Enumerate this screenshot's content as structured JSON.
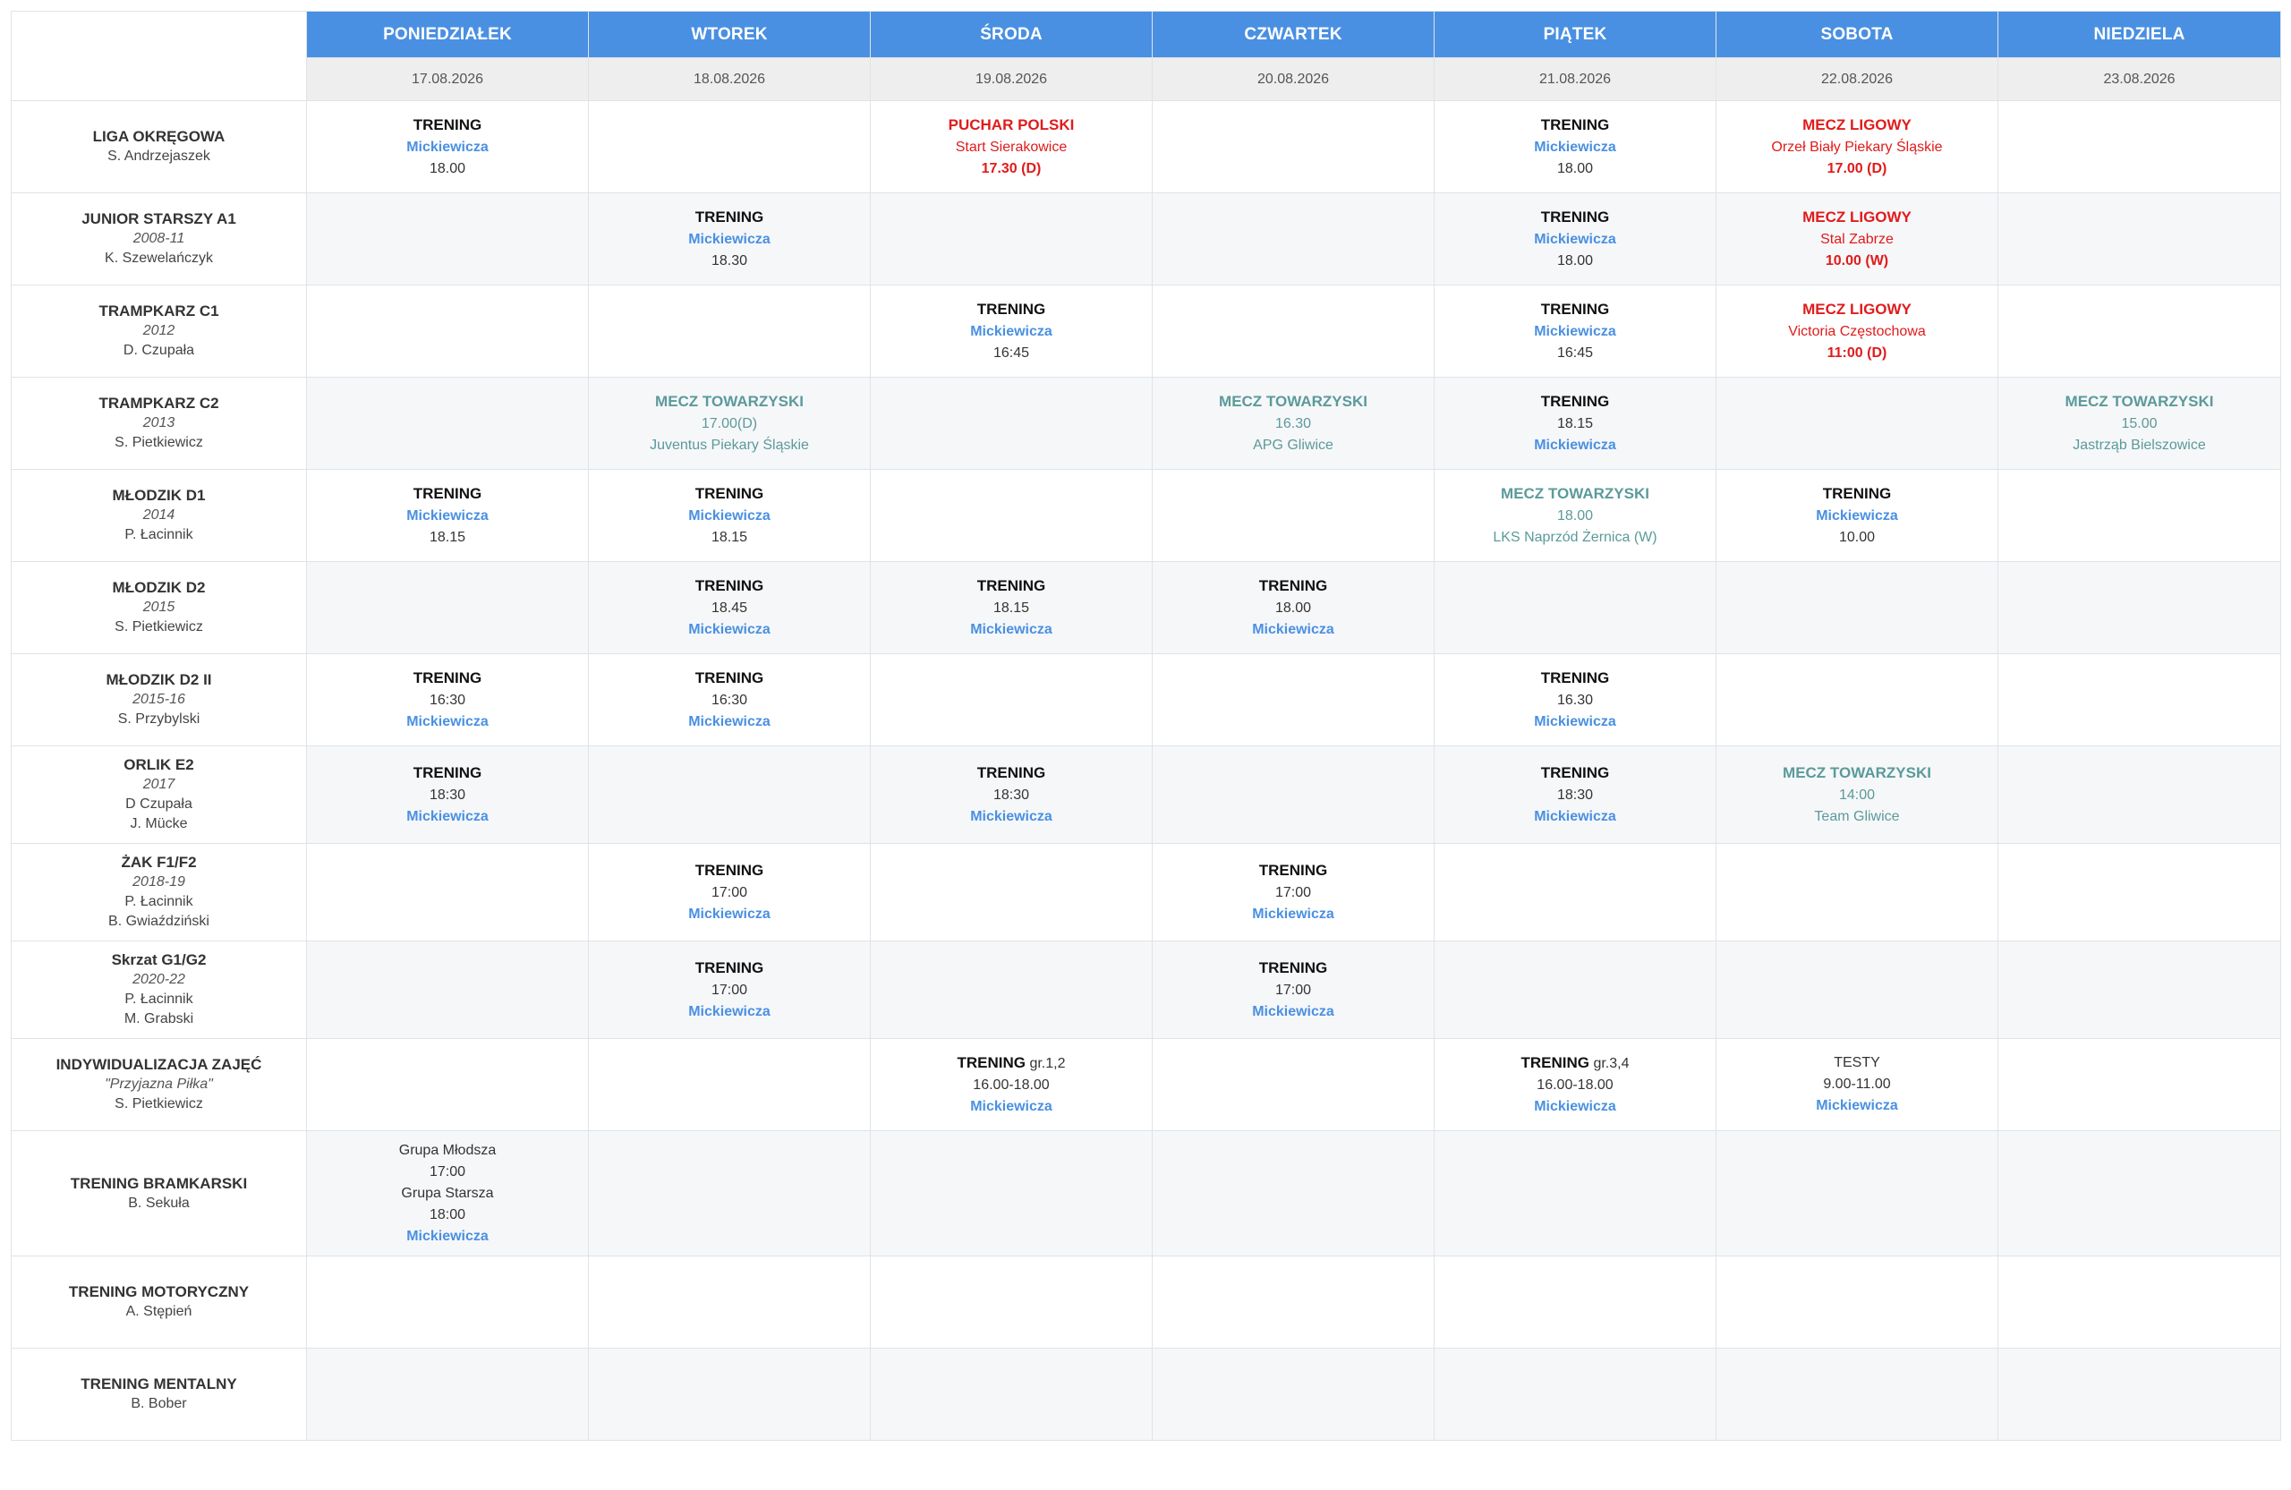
{
  "days": [
    {
      "name": "PONIEDZIAŁEK",
      "date": "17.08.2026"
    },
    {
      "name": "WTOREK",
      "date": "18.08.2026"
    },
    {
      "name": "ŚRODA",
      "date": "19.08.2026"
    },
    {
      "name": "CZWARTEK",
      "date": "20.08.2026"
    },
    {
      "name": "PIĄTEK",
      "date": "21.08.2026"
    },
    {
      "name": "SOBOTA",
      "date": "22.08.2026"
    },
    {
      "name": "NIEDZIELA",
      "date": "23.08.2026"
    }
  ],
  "rows": [
    {
      "name": "LIGA OKRĘGOWA",
      "year": "",
      "coaches": [
        "S. Andrzejaszek"
      ],
      "height": 103,
      "cells": [
        [
          {
            "t": "TRENING",
            "k": "trening"
          },
          {
            "t": "Mickiewicza",
            "k": "place"
          },
          {
            "t": "18.00",
            "k": "time"
          }
        ],
        [],
        [
          {
            "t": "PUCHAR POLSKI",
            "k": "mecz"
          },
          {
            "t": "Start Sierakowice",
            "k": "mecz-sub"
          },
          {
            "t": "17.30 (D)",
            "k": "mecz-time"
          }
        ],
        [],
        [
          {
            "t": "TRENING",
            "k": "trening"
          },
          {
            "t": "Mickiewicza",
            "k": "place"
          },
          {
            "t": "18.00",
            "k": "time"
          }
        ],
        [
          {
            "t": "MECZ LIGOWY",
            "k": "mecz"
          },
          {
            "t": "Orzeł Biały Piekary Śląskie",
            "k": "mecz-sub"
          },
          {
            "t": "17.00 (D)",
            "k": "mecz-time"
          }
        ],
        []
      ]
    },
    {
      "name": "JUNIOR STARSZY A1",
      "year": "2008-11",
      "coaches": [
        "K. Szewelańczyk"
      ],
      "height": 103,
      "cells": [
        [],
        [
          {
            "t": "TRENING",
            "k": "trening"
          },
          {
            "t": "Mickiewicza",
            "k": "place"
          },
          {
            "t": "18.30",
            "k": "time"
          }
        ],
        [],
        [],
        [
          {
            "t": "TRENING",
            "k": "trening"
          },
          {
            "t": "Mickiewicza",
            "k": "place"
          },
          {
            "t": "18.00",
            "k": "time"
          }
        ],
        [
          {
            "t": "MECZ LIGOWY",
            "k": "mecz"
          },
          {
            "t": "Stal Zabrze",
            "k": "mecz-sub"
          },
          {
            "t": "10.00 (W)",
            "k": "mecz-time"
          }
        ],
        []
      ]
    },
    {
      "name": "TRAMPKARZ C1",
      "year": "2012",
      "coaches": [
        "D. Czupała"
      ],
      "height": 103,
      "cells": [
        [],
        [],
        [
          {
            "t": "TRENING",
            "k": "trening"
          },
          {
            "t": "Mickiewicza",
            "k": "place"
          },
          {
            "t": "16:45",
            "k": "time"
          }
        ],
        [],
        [
          {
            "t": "TRENING",
            "k": "trening"
          },
          {
            "t": "Mickiewicza",
            "k": "place"
          },
          {
            "t": "16:45",
            "k": "time"
          }
        ],
        [
          {
            "t": "MECZ LIGOWY",
            "k": "mecz"
          },
          {
            "t": "Victoria Częstochowa",
            "k": "mecz-sub"
          },
          {
            "t": "11:00 (D)",
            "k": "mecz-time"
          }
        ],
        []
      ]
    },
    {
      "name": "TRAMPKARZ C2",
      "year": "2013",
      "coaches": [
        "S. Pietkiewicz"
      ],
      "height": 103,
      "cells": [
        [],
        [
          {
            "t": "MECZ TOWARZYSKI",
            "k": "friendly"
          },
          {
            "t": "17.00(D)",
            "k": "friendly-sub"
          },
          {
            "t": "Juventus Piekary Śląskie",
            "k": "friendly-sub"
          }
        ],
        [],
        [
          {
            "t": "MECZ TOWARZYSKI",
            "k": "friendly"
          },
          {
            "t": "16.30",
            "k": "friendly-sub"
          },
          {
            "t": "APG Gliwice",
            "k": "friendly-sub"
          }
        ],
        [
          {
            "t": "TRENING",
            "k": "trening"
          },
          {
            "t": "18.15",
            "k": "time"
          },
          {
            "t": "Mickiewicza",
            "k": "place"
          }
        ],
        [],
        [
          {
            "t": "MECZ TOWARZYSKI",
            "k": "friendly"
          },
          {
            "t": "15.00",
            "k": "friendly-sub"
          },
          {
            "t": "Jastrząb Bielszowice",
            "k": "friendly-sub"
          }
        ]
      ]
    },
    {
      "name": "MŁODZIK D1",
      "year": "2014",
      "coaches": [
        "P. Łacinnik"
      ],
      "height": 103,
      "cells": [
        [
          {
            "t": "TRENING",
            "k": "trening"
          },
          {
            "t": "Mickiewicza",
            "k": "place"
          },
          {
            "t": "18.15",
            "k": "time"
          }
        ],
        [
          {
            "t": "TRENING",
            "k": "trening"
          },
          {
            "t": "Mickiewicza",
            "k": "place"
          },
          {
            "t": "18.15",
            "k": "time"
          }
        ],
        [],
        [],
        [
          {
            "t": "MECZ TOWARZYSKI",
            "k": "friendly"
          },
          {
            "t": "18.00",
            "k": "friendly-sub"
          },
          {
            "t": "LKS Naprzód Żernica (W)",
            "k": "friendly-sub"
          }
        ],
        [
          {
            "t": "TRENING",
            "k": "trening"
          },
          {
            "t": "Mickiewicza",
            "k": "place"
          },
          {
            "t": "10.00",
            "k": "time"
          }
        ],
        []
      ]
    },
    {
      "name": "MŁODZIK D2",
      "year": "2015",
      "coaches": [
        "S. Pietkiewicz"
      ],
      "height": 103,
      "cells": [
        [],
        [
          {
            "t": "TRENING",
            "k": "trening"
          },
          {
            "t": "18.45",
            "k": "time"
          },
          {
            "t": "Mickiewicza",
            "k": "place"
          }
        ],
        [
          {
            "t": "TRENING",
            "k": "trening"
          },
          {
            "t": "18.15",
            "k": "time"
          },
          {
            "t": "Mickiewicza",
            "k": "place"
          }
        ],
        [
          {
            "t": "TRENING",
            "k": "trening"
          },
          {
            "t": "18.00",
            "k": "time"
          },
          {
            "t": "Mickiewicza",
            "k": "place"
          }
        ],
        [],
        [],
        []
      ]
    },
    {
      "name": "MŁODZIK D2 II",
      "year": "2015-16",
      "coaches": [
        "S. Przybylski"
      ],
      "height": 103,
      "cells": [
        [
          {
            "t": "TRENING",
            "k": "trening"
          },
          {
            "t": "16:30",
            "k": "time"
          },
          {
            "t": "Mickiewicza",
            "k": "place"
          }
        ],
        [
          {
            "t": "TRENING",
            "k": "trening"
          },
          {
            "t": "16:30",
            "k": "time"
          },
          {
            "t": "Mickiewicza",
            "k": "place"
          }
        ],
        [],
        [],
        [
          {
            "t": "TRENING",
            "k": "trening"
          },
          {
            "t": "16.30",
            "k": "time"
          },
          {
            "t": "Mickiewicza",
            "k": "place"
          }
        ],
        [],
        []
      ]
    },
    {
      "name": "ORLIK E2",
      "year": "2017",
      "coaches": [
        "D Czupała",
        "J. Mücke"
      ],
      "height": 109,
      "cells": [
        [
          {
            "t": "TRENING",
            "k": "trening"
          },
          {
            "t": "18:30",
            "k": "time"
          },
          {
            "t": "Mickiewicza",
            "k": "place"
          }
        ],
        [],
        [
          {
            "t": "TRENING",
            "k": "trening"
          },
          {
            "t": "18:30",
            "k": "time"
          },
          {
            "t": "Mickiewicza",
            "k": "place"
          }
        ],
        [],
        [
          {
            "t": "TRENING",
            "k": "trening"
          },
          {
            "t": "18:30",
            "k": "time"
          },
          {
            "t": "Mickiewicza",
            "k": "place"
          }
        ],
        [
          {
            "t": "MECZ TOWARZYSKI",
            "k": "friendly"
          },
          {
            "t": "14:00",
            "k": "friendly-sub"
          },
          {
            "t": "Team Gliwice",
            "k": "friendly-sub"
          }
        ],
        []
      ]
    },
    {
      "name": "ŻAK F1/F2",
      "year": "2018-19",
      "coaches": [
        "P. Łacinnik",
        "B. Gwiaździński"
      ],
      "height": 109,
      "cells": [
        [],
        [
          {
            "t": "TRENING",
            "k": "trening"
          },
          {
            "t": "17:00",
            "k": "time"
          },
          {
            "t": "Mickiewicza",
            "k": "place"
          }
        ],
        [],
        [
          {
            "t": "TRENING",
            "k": "trening"
          },
          {
            "t": "17:00",
            "k": "time"
          },
          {
            "t": "Mickiewicza",
            "k": "place"
          }
        ],
        [],
        [],
        []
      ]
    },
    {
      "name": "Skrzat G1/G2",
      "year": "2020-22",
      "coaches": [
        "P. Łacinnik",
        "M. Grabski"
      ],
      "height": 109,
      "cells": [
        [],
        [
          {
            "t": "TRENING",
            "k": "trening"
          },
          {
            "t": "17:00",
            "k": "time"
          },
          {
            "t": "Mickiewicza",
            "k": "place"
          }
        ],
        [],
        [
          {
            "t": "TRENING",
            "k": "trening"
          },
          {
            "t": "17:00",
            "k": "time"
          },
          {
            "t": "Mickiewicza",
            "k": "place"
          }
        ],
        [],
        [],
        []
      ]
    },
    {
      "name": "INDYWIDUALIZACJA ZAJĘĆ",
      "year": "\"Przyjazna Piłka\"",
      "coaches": [
        "S. Pietkiewicz"
      ],
      "height": 103,
      "cells": [
        [],
        [],
        [
          {
            "t": "TRENING",
            "k": "trening",
            "suffix": " gr.1,2"
          },
          {
            "t": "16.00-18.00",
            "k": "time"
          },
          {
            "t": "Mickiewicza",
            "k": "place"
          }
        ],
        [],
        [
          {
            "t": "TRENING",
            "k": "trening",
            "suffix": " gr.3,4"
          },
          {
            "t": "16.00-18.00",
            "k": "time"
          },
          {
            "t": "Mickiewicza",
            "k": "place"
          }
        ],
        [
          {
            "t": "TESTY",
            "k": "plain"
          },
          {
            "t": "9.00-11.00",
            "k": "time"
          },
          {
            "t": "Mickiewicza",
            "k": "place"
          }
        ],
        []
      ]
    },
    {
      "name": "TRENING BRAMKARSKI",
      "year": "",
      "coaches": [
        "B. Sekuła"
      ],
      "height": 140,
      "cells": [
        [
          {
            "t": "Grupa Młodsza",
            "k": "plain"
          },
          {
            "t": "17:00",
            "k": "time"
          },
          {
            "t": "Grupa Starsza",
            "k": "plain"
          },
          {
            "t": "18:00",
            "k": "time"
          },
          {
            "t": "Mickiewicza",
            "k": "place"
          }
        ],
        [],
        [],
        [],
        [],
        [],
        []
      ]
    },
    {
      "name": "TRENING MOTORYCZNY",
      "year": "",
      "coaches": [
        "A. Stępień"
      ],
      "height": 103,
      "cells": [
        [],
        [],
        [],
        [],
        [],
        [],
        []
      ]
    },
    {
      "name": "TRENING MENTALNY",
      "year": "",
      "coaches": [
        "B. Bober"
      ],
      "height": 103,
      "cells": [
        [],
        [],
        [],
        [],
        [],
        [],
        []
      ]
    }
  ]
}
